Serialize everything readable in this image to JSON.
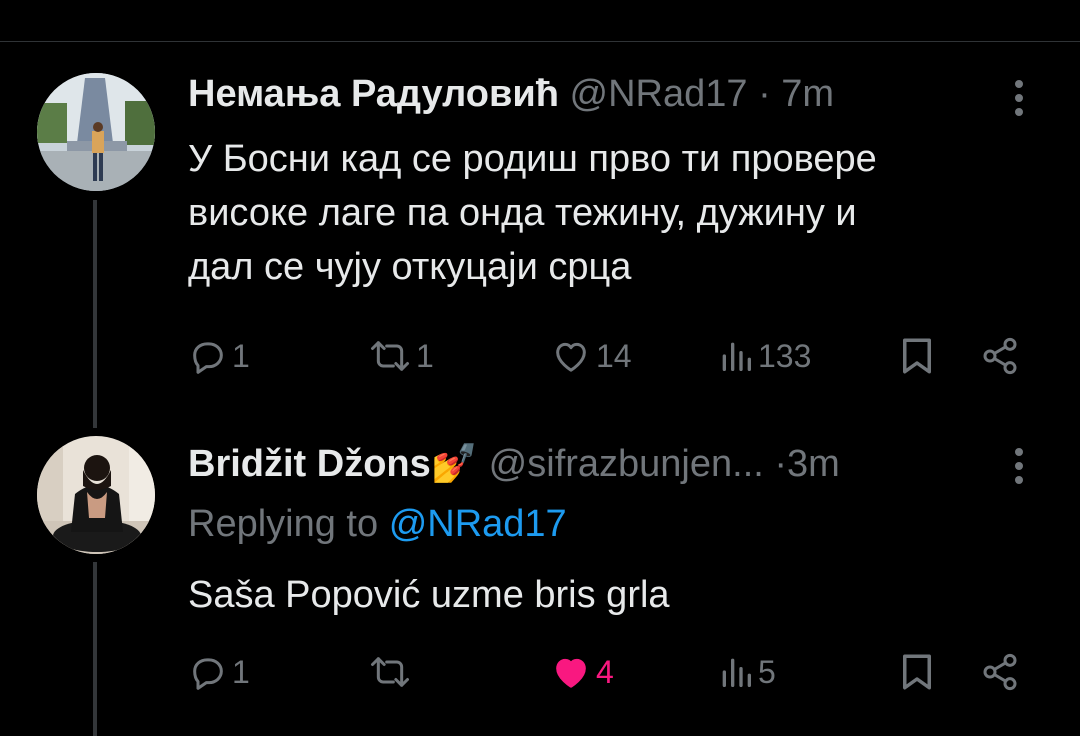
{
  "tweets": [
    {
      "author_name": "Немања Радуловић",
      "handle": "@NRad17",
      "separator": "·",
      "time": "7m",
      "text_lines": [
        "У Босни кад се родиш прво ти провере",
        "високе лаге па онда тежину, дужину и",
        "дал се чују откуцаји срца"
      ],
      "actions": {
        "replies": "1",
        "reposts": "1",
        "likes": "14",
        "views": "133"
      },
      "liked": false
    },
    {
      "author_name": "Bridžit Džons",
      "emoji": "💅",
      "handle": "@sifrazbunjen...",
      "separator": "·",
      "time": "3m",
      "replying_prefix": "Replying to",
      "replying_to": "@NRad17",
      "text_lines": [
        "Saša Popović uzme bris grla"
      ],
      "actions": {
        "replies": "1",
        "reposts": "",
        "likes": "4",
        "views": "5"
      },
      "liked": true
    }
  ],
  "colors": {
    "background": "#000000",
    "text": "#e7e9ea",
    "muted": "#71767b",
    "link": "#1d9bf0",
    "like": "#f91880"
  },
  "icons": [
    "reply-icon",
    "repost-icon",
    "like-icon",
    "views-icon",
    "bookmark-icon",
    "share-icon",
    "more-icon"
  ]
}
